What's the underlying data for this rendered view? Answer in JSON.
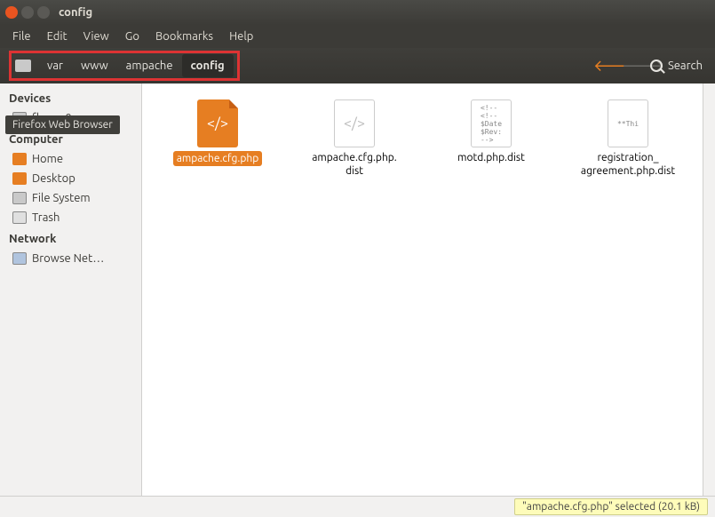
{
  "window": {
    "title": "config"
  },
  "menubar": [
    "File",
    "Edit",
    "View",
    "Go",
    "Bookmarks",
    "Help"
  ],
  "breadcrumb": [
    "var",
    "www",
    "ampache",
    "config"
  ],
  "toolbar": {
    "search_label": "Search"
  },
  "sidebar": {
    "devices_heading": "Devices",
    "devices": [
      {
        "label": "floppy0",
        "icon": "floppy"
      }
    ],
    "computer_heading": "Computer",
    "computer": [
      {
        "label": "Home",
        "icon": "home"
      },
      {
        "label": "Desktop",
        "icon": "desktop"
      },
      {
        "label": "File System",
        "icon": "fs"
      },
      {
        "label": "Trash",
        "icon": "trash"
      }
    ],
    "network_heading": "Network",
    "network": [
      {
        "label": "Browse Net…",
        "icon": "net"
      }
    ]
  },
  "files": [
    {
      "name": "ampache.cfg.php",
      "type": "code",
      "selected": true
    },
    {
      "name": "ampache.cfg.php.\ndist",
      "type": "code",
      "selected": false
    },
    {
      "name": "motd.php.dist",
      "type": "txt",
      "preview": "<!--\n<!--\n$Date\n$Rev:\n-->",
      "selected": false
    },
    {
      "name": "registration_\nagreement.php.dist",
      "type": "txt",
      "preview": "**Thi",
      "selected": false
    }
  ],
  "statusbar": {
    "text": "\"ampache.cfg.php\" selected (20.1 kB)"
  },
  "tooltip": "Firefox Web Browser"
}
